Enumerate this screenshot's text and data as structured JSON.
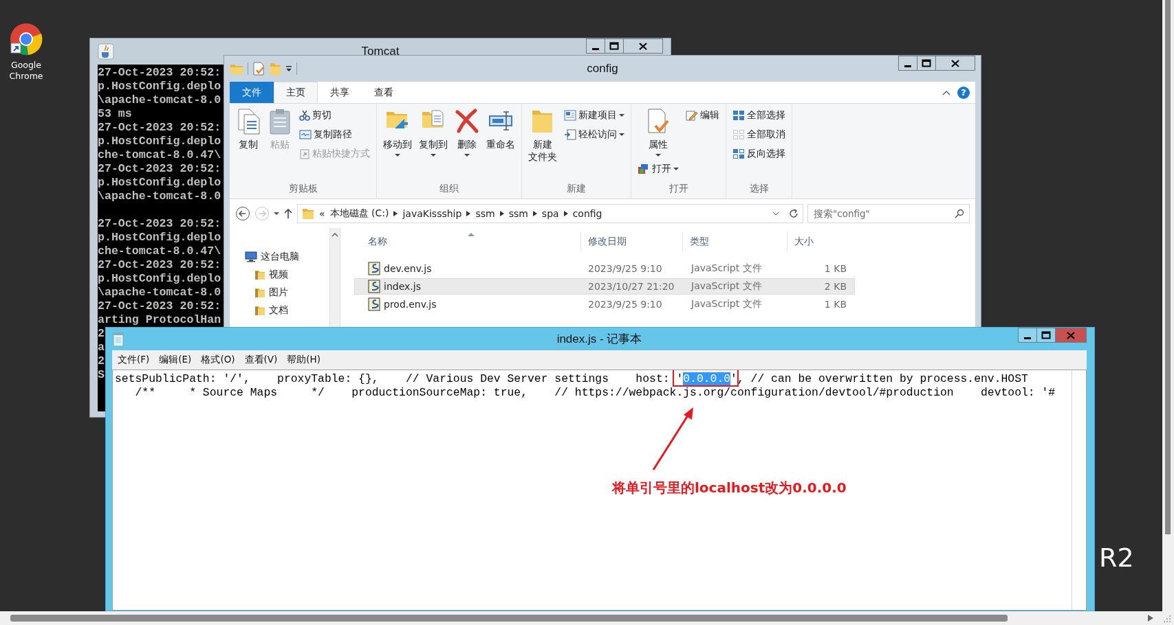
{
  "desktop": {
    "shortcut": {
      "label": "Google Chrome"
    },
    "wallpaper_text": "R2"
  },
  "tomcat": {
    "title": "Tomcat",
    "console_blocks": [
      [
        "27-Oct-2023 20:52:",
        "p.HostConfig.deplo",
        "\\apache-tomcat-8.0",
        "53 ms",
        "27-Oct-2023 20:52:",
        "p.HostConfig.deplo",
        "che-tomcat-8.0.47\\",
        "27-Oct-2023 20:52:",
        "p.HostConfig.deplo",
        "\\apache-tomcat-8.0"
      ],
      [
        "27-Oct-2023 20:52:",
        "p.HostConfig.deplo",
        "che-tomcat-8.0.47\\",
        "27-Oct-2023 20:52:",
        "p.HostConfig.deplo",
        "\\apache-tomcat-8.0",
        "27-Oct-2023 20:52:",
        "arting ProtocolHan",
        "2",
        "a",
        "2",
        "S"
      ]
    ]
  },
  "explorer": {
    "title": "config",
    "ribbon_tabs": [
      {
        "label": "文件",
        "kind": "file",
        "selected": false
      },
      {
        "label": "主页",
        "kind": "tab",
        "selected": true
      },
      {
        "label": "共享",
        "kind": "tab",
        "selected": false
      },
      {
        "label": "查看",
        "kind": "tab",
        "selected": false
      }
    ],
    "help": "?",
    "ribbon_groups": [
      {
        "label": "剪贴板",
        "columns": [
          [
            {
              "label": "复制",
              "kind": "large",
              "disabled": false,
              "dropdown": false
            }
          ],
          [
            {
              "label": "粘贴",
              "kind": "large",
              "disabled": true,
              "dropdown": false
            }
          ],
          [
            {
              "label": "剪切",
              "kind": "small",
              "disabled": false,
              "dropdown": false
            },
            {
              "label": "复制路径",
              "kind": "small",
              "disabled": false,
              "dropdown": false
            },
            {
              "label": "粘贴快捷方式",
              "kind": "small",
              "disabled": true,
              "dropdown": false
            }
          ]
        ]
      },
      {
        "label": "组织",
        "columns": [
          [
            {
              "label": "移动到",
              "kind": "large",
              "disabled": false,
              "dropdown": true
            }
          ],
          [
            {
              "label": "复制到",
              "kind": "large",
              "disabled": false,
              "dropdown": true
            }
          ],
          [
            {
              "label": "删除",
              "kind": "large",
              "disabled": false,
              "dropdown": true
            }
          ],
          [
            {
              "label": "重命名",
              "kind": "large",
              "disabled": false,
              "dropdown": false
            }
          ]
        ]
      },
      {
        "label": "新建",
        "columns": [
          [
            {
              "label": [
                "新建",
                "文件夹"
              ],
              "kind": "large",
              "disabled": false,
              "dropdown": false
            }
          ],
          [
            {
              "label": "新建项目",
              "kind": "small",
              "disabled": false,
              "dropdown": true
            },
            {
              "label": "轻松访问",
              "kind": "small",
              "disabled": false,
              "dropdown": true
            }
          ]
        ]
      },
      {
        "label": "打开",
        "columns": [
          [
            {
              "label": "属性",
              "kind": "large",
              "disabled": false,
              "dropdown": true
            },
            {
              "label": "打开",
              "kind": "small",
              "disabled": false,
              "dropdown": true
            }
          ],
          [
            {
              "label": "编辑",
              "kind": "small",
              "disabled": false,
              "dropdown": false
            }
          ]
        ]
      },
      {
        "label": "选择",
        "columns": [
          [
            {
              "label": "全部选择",
              "kind": "small",
              "disabled": false,
              "dropdown": false
            },
            {
              "label": "全部取消",
              "kind": "small",
              "disabled": false,
              "dropdown": false
            },
            {
              "label": "反向选择",
              "kind": "small",
              "disabled": false,
              "dropdown": false
            }
          ]
        ]
      }
    ],
    "nav_buttons": [
      {
        "kind": "back",
        "disabled": false
      },
      {
        "kind": "forward",
        "disabled": true
      }
    ],
    "address": {
      "overflow": "«",
      "segments": [
        "本地磁盘 (C:)",
        "javaKissship",
        "ssm",
        "ssm",
        "spa",
        "config"
      ]
    },
    "search": {
      "placeholder": "搜索\"config\""
    },
    "nav_tree": [
      {
        "label": "这台电脑",
        "children": [
          {
            "label": "视频"
          },
          {
            "label": "图片"
          },
          {
            "label": "文档"
          }
        ]
      }
    ],
    "files": {
      "columns": [
        {
          "label": "名称",
          "sorted": true
        },
        {
          "label": "修改日期",
          "sorted": false
        },
        {
          "label": "类型",
          "sorted": false
        },
        {
          "label": "大小",
          "sorted": false
        }
      ],
      "rows": [
        {
          "cells": [
            "dev.env.js",
            "2023/9/25 9:10",
            "JavaScript 文件",
            "1 KB"
          ],
          "selected": false
        },
        {
          "cells": [
            "index.js",
            "2023/10/27 21:20",
            "JavaScript 文件",
            "2 KB"
          ],
          "selected": true
        },
        {
          "cells": [
            "prod.env.js",
            "2023/9/25 9:10",
            "JavaScript 文件",
            "1 KB"
          ],
          "selected": false
        }
      ]
    }
  },
  "notepad": {
    "title": "index.js - 记事本",
    "menu": [
      "文件(F)",
      "编辑(E)",
      "格式(O)",
      "查看(V)",
      "帮助(H)"
    ],
    "lines": [
      {
        "segments": [
          {
            "text": "setsPublicPath: '/',    proxyTable: {},    // Various Dev Server settings    host: '",
            "selected": false,
            "annotated": false
          },
          {
            "text": "0.0.0.0",
            "selected": true,
            "annotated": true
          },
          {
            "text": "', // can be overwritten by process.env.HOST",
            "selected": false,
            "annotated": false
          }
        ]
      },
      {
        "segments": [
          {
            "text": "   /**     * Source Maps     */    productionSourceMap: true,    // https://webpack.js.org/configuration/devtool/#production    devtool: '#",
            "selected": false,
            "annotated": false
          }
        ]
      }
    ]
  },
  "annotation": {
    "text": "将单引号里的localhost改为0.0.0.0"
  }
}
